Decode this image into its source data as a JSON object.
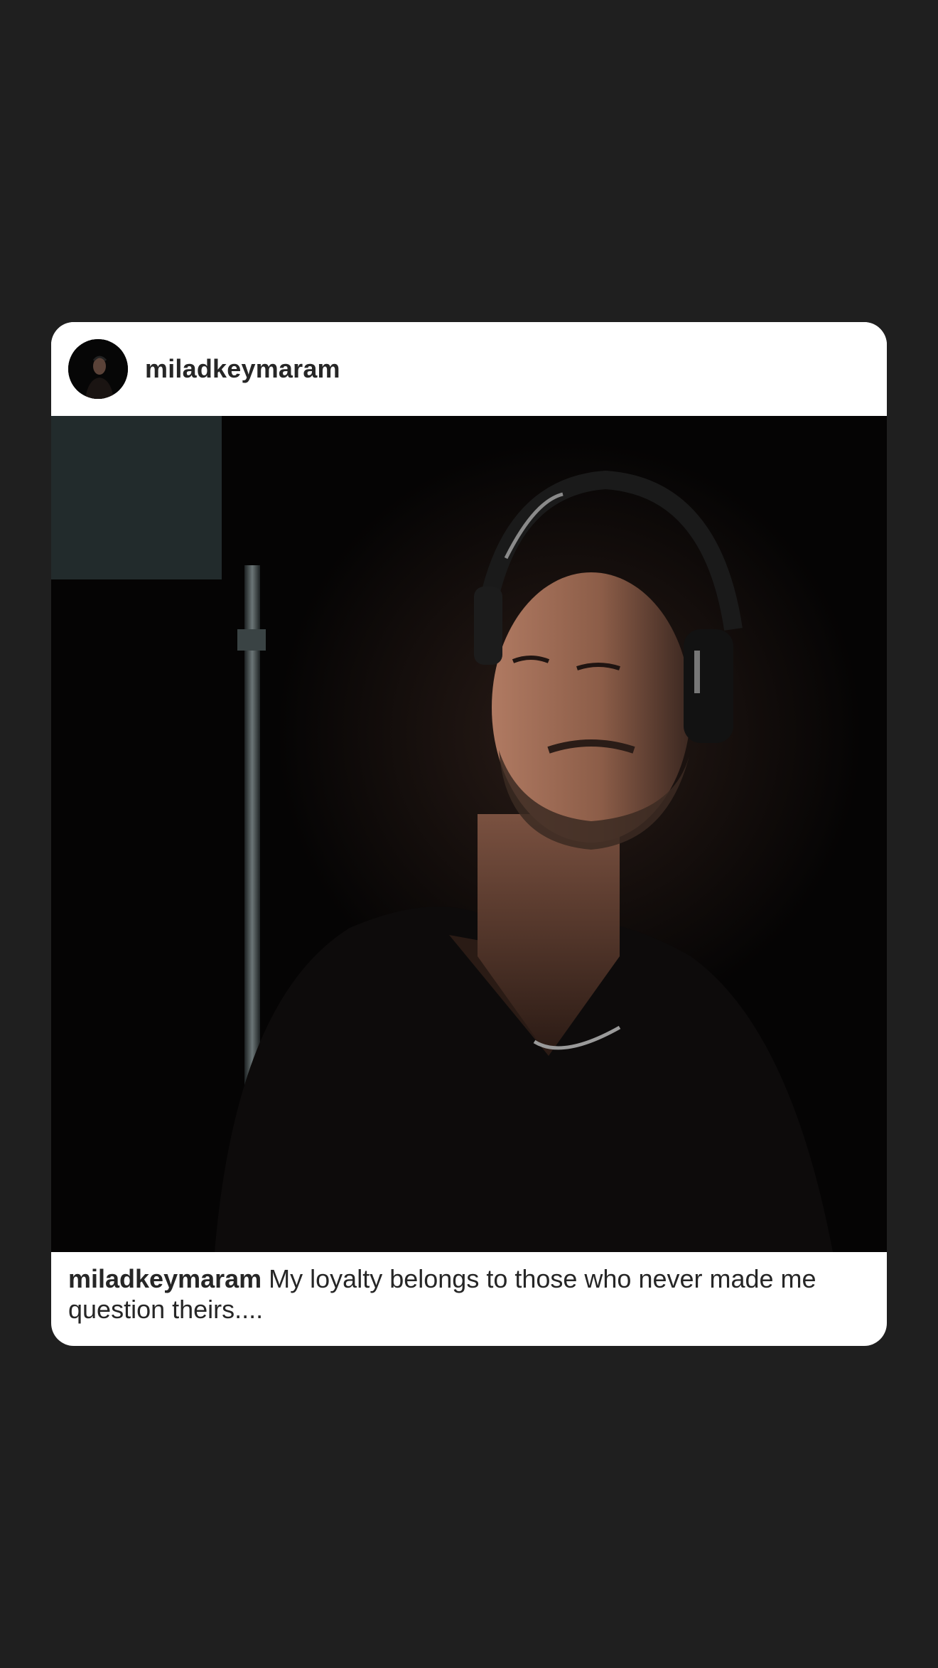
{
  "post": {
    "username": "miladkeymaram",
    "avatar_icon": "profile-photo-avatar",
    "caption": {
      "username": "miladkeymaram",
      "text": " My loyalty belongs to those who never made me question theirs...."
    }
  },
  "colors": {
    "background": "#1f1f1f",
    "card": "#ffffff",
    "text": "#262626"
  }
}
